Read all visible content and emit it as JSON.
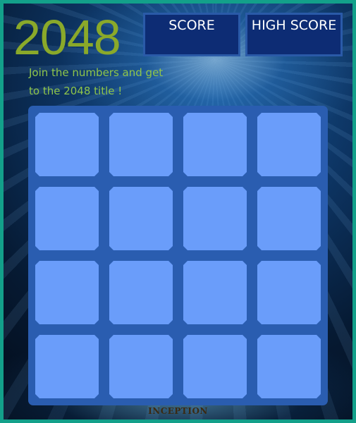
{
  "game": {
    "title": "2048",
    "tagline": "Join the numbers and get to the 2048 title !"
  },
  "scoreboard": {
    "score_label": "SCORE",
    "score_value": "",
    "high_score_label": "HIGH SCORE",
    "high_score_value": ""
  },
  "board": {
    "rows": 4,
    "cols": 4,
    "tiles": [
      [
        "",
        "",
        "",
        ""
      ],
      [
        "",
        "",
        "",
        ""
      ],
      [
        "",
        "",
        "",
        ""
      ],
      [
        "",
        "",
        "",
        ""
      ]
    ]
  },
  "footer": {
    "brand": "INCEPTION"
  },
  "colors": {
    "frame_border": "#13a08a",
    "title": "#8aa92a",
    "tagline": "#8fc54a",
    "score_box": "#0d2c74",
    "board": "#2a5db0",
    "empty_tile": "#6a9dfa"
  }
}
